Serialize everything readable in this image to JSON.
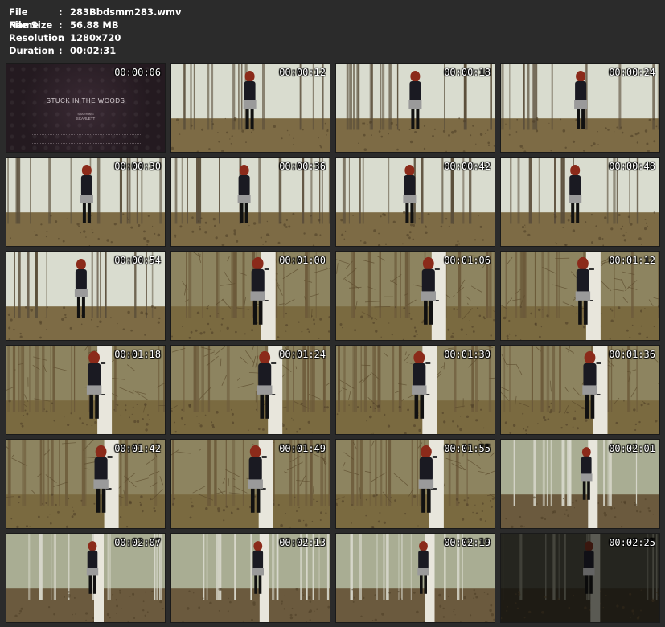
{
  "file_info": {
    "rows": [
      {
        "label": "File Name",
        "value": "283Bbdsmm283.wmv"
      },
      {
        "label": "File Size",
        "value": "56.88 MB"
      },
      {
        "label": "Resolution",
        "value": "1280x720"
      },
      {
        "label": "Duration",
        "value": "00:02:31"
      }
    ],
    "separator": ":"
  },
  "title_card": {
    "title": "STUCK IN THE WOODS",
    "sub": "STARRING",
    "name": "SCARLETT"
  },
  "thumbnails": [
    {
      "time": "00:00:06",
      "scene": "title"
    },
    {
      "time": "00:00:12",
      "scene": "forest"
    },
    {
      "time": "00:00:18",
      "scene": "forest"
    },
    {
      "time": "00:00:24",
      "scene": "forest"
    },
    {
      "time": "00:00:30",
      "scene": "forest"
    },
    {
      "time": "00:00:36",
      "scene": "forest"
    },
    {
      "time": "00:00:42",
      "scene": "forest"
    },
    {
      "time": "00:00:48",
      "scene": "forest"
    },
    {
      "time": "00:00:54",
      "scene": "forest"
    },
    {
      "time": "00:01:00",
      "scene": "tree"
    },
    {
      "time": "00:01:06",
      "scene": "tree"
    },
    {
      "time": "00:01:12",
      "scene": "tree"
    },
    {
      "time": "00:01:18",
      "scene": "tree"
    },
    {
      "time": "00:01:24",
      "scene": "tree"
    },
    {
      "time": "00:01:30",
      "scene": "tree"
    },
    {
      "time": "00:01:36",
      "scene": "tree"
    },
    {
      "time": "00:01:42",
      "scene": "tree"
    },
    {
      "time": "00:01:49",
      "scene": "tree"
    },
    {
      "time": "00:01:55",
      "scene": "tree"
    },
    {
      "time": "00:02:01",
      "scene": "wide"
    },
    {
      "time": "00:02:07",
      "scene": "wide"
    },
    {
      "time": "00:02:13",
      "scene": "wide"
    },
    {
      "time": "00:02:19",
      "scene": "wide"
    },
    {
      "time": "00:02:25",
      "scene": "dark"
    }
  ]
}
